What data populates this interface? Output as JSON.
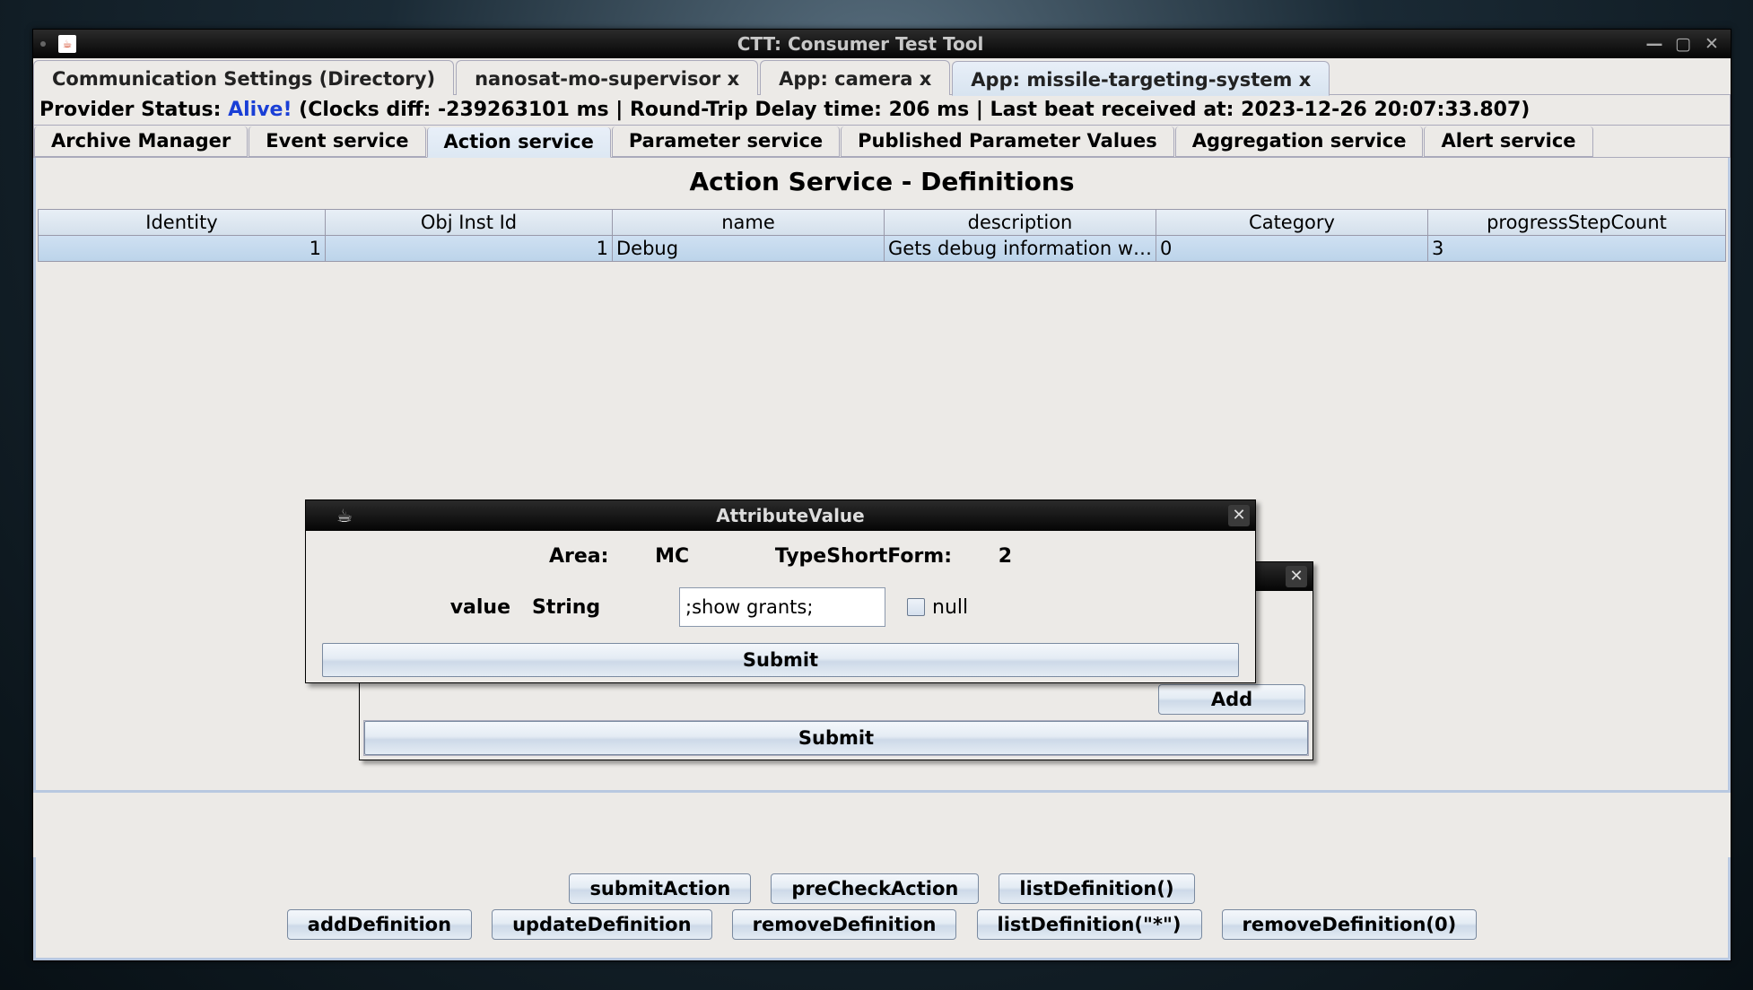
{
  "window": {
    "title": "CTT: Consumer Test Tool"
  },
  "top_tabs": {
    "t0": "Communication Settings (Directory)",
    "t1": "nanosat-mo-supervisor x",
    "t2": "App: camera x",
    "t3": "App: missile-targeting-system x"
  },
  "status": {
    "prefix": "Provider Status: ",
    "alive": "Alive!",
    "rest": " (Clocks diff: -239263101 ms | Round-Trip Delay time: 206 ms | Last beat received at: 2023-12-26 20:07:33.807)"
  },
  "sub_tabs": {
    "s0": "Archive Manager",
    "s1": "Event service",
    "s2": "Action service",
    "s3": "Parameter service",
    "s4": "Published Parameter Values",
    "s5": "Aggregation service",
    "s6": "Alert service"
  },
  "panel": {
    "heading": "Action Service - Definitions",
    "columns": {
      "identity": "Identity",
      "objinst": "Obj Inst Id",
      "name": "name",
      "desc": "description",
      "cat": "Category",
      "prog": "progressStepCount"
    },
    "row": {
      "identity": "1",
      "objinst": "1",
      "name": "Debug",
      "desc": "Gets debug information wi...",
      "cat": "0",
      "prog": "3"
    }
  },
  "buttons": {
    "submitAction": "submitAction",
    "preCheckAction": "preCheckAction",
    "listDefinitionEmpty": "listDefinition()",
    "addDefinition": "addDefinition",
    "updateDefinition": "updateDefinition",
    "removeDefinition": "removeDefinition",
    "listDefinitionStar": "listDefinition(\"*\")",
    "removeDefinitionZero": "removeDefinition(0)"
  },
  "back_dialog": {
    "add": "Add",
    "submit": "Submit"
  },
  "front_dialog": {
    "title": "AttributeValue",
    "area_label": "Area: ",
    "area_value": "MC",
    "tsf_label": "TypeShortForm: ",
    "tsf_value": "2",
    "value_label": "value",
    "type_label": "String",
    "input_value": ";show grants;",
    "null_label": "null",
    "submit": "Submit"
  }
}
